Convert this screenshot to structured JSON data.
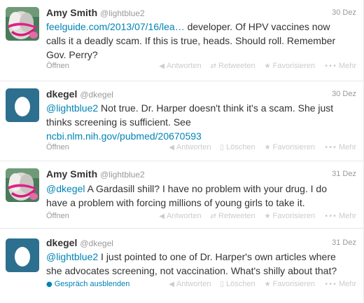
{
  "tweets": [
    {
      "fullname": "Amy Smith",
      "username": "@lightblue2",
      "time": "30 Dez",
      "avatar": "amy-avatar",
      "text_link": "feelguide.com/2013/07/16/lea…",
      "text_line1_rest": " developer. Of HPV vaccines now",
      "text_line2": "calls it a deadly scam.  If this is true, heads. Should roll. Remember",
      "text_line3": "Gov. Perry?",
      "open_label": "Öffnen",
      "actions": [
        "Antworten",
        "Retweeten",
        "Favorisieren",
        "Mehr"
      ]
    },
    {
      "fullname": "dkegel",
      "username": "@dkegel",
      "time": "30 Dez",
      "avatar": "egg-avatar",
      "mention": "@lightblue2",
      "text_line1_rest": " Not true.  Dr. Harper doesn't think it's a scam.  She just",
      "text_line2": "thinks screening is sufficient.  See",
      "text_link": "ncbi.nlm.nih.gov/pubmed/20670593",
      "open_label": "Öffnen",
      "actions": [
        "Antworten",
        "Löschen",
        "Favorisieren",
        "Mehr"
      ]
    },
    {
      "fullname": "Amy Smith",
      "username": "@lightblue2",
      "time": "31 Dez",
      "avatar": "amy-avatar",
      "mention": "@dkegel",
      "text_line1_rest": "  A Gardasill shill? I have no problem with your drug. I do",
      "text_line2": "have a problem with forcing millions of young girls to take it.",
      "open_label": "Öffnen",
      "actions": [
        "Antworten",
        "Retweeten",
        "Favorisieren",
        "Mehr"
      ]
    },
    {
      "fullname": "dkegel",
      "username": "@dkegel",
      "time": "31 Dez",
      "avatar": "egg-avatar",
      "mention": "@lightblue2",
      "text_line1_rest": " I just pointed to one of Dr. Harper's own articles where",
      "text_line2": "she advocates screening, not vaccination.  What's shilly about that?",
      "open_label": "Gespräch ausblenden",
      "actions": [
        "Antworten",
        "Löschen",
        "Favorisieren",
        "Mehr"
      ]
    }
  ],
  "colors": {
    "link": "#0084b4",
    "text": "#333333",
    "muted": "#999999",
    "action": "#cccccc",
    "egg_bg": "#2d6f8e",
    "divider": "#e8e8e8"
  }
}
